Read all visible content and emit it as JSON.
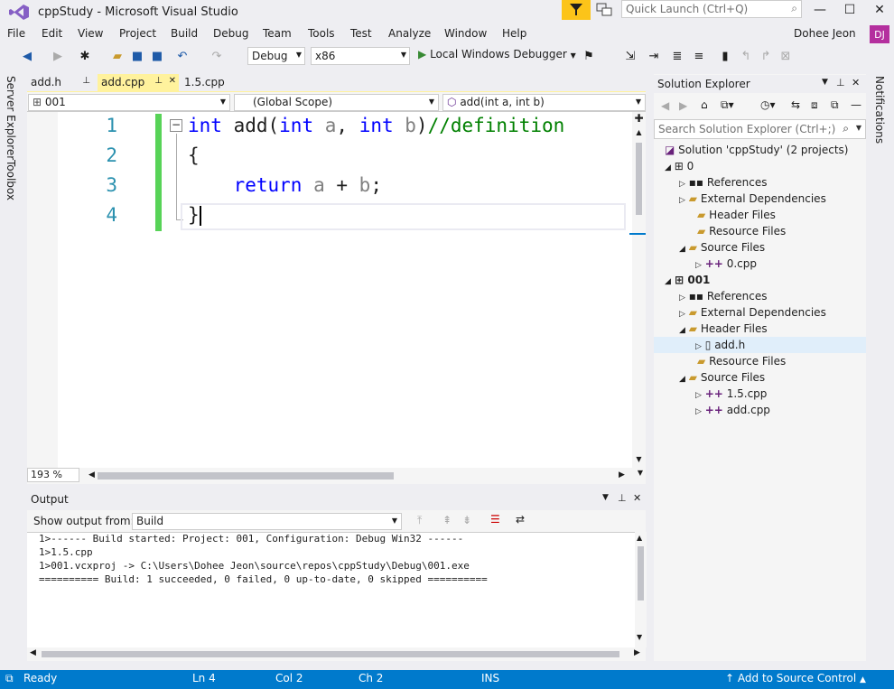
{
  "window": {
    "title": "cppStudy - Microsoft Visual Studio",
    "quick_launch_placeholder": "Quick Launch (Ctrl+Q)"
  },
  "menu": [
    "File",
    "Edit",
    "View",
    "Project",
    "Build",
    "Debug",
    "Team",
    "Tools",
    "Test",
    "Analyze",
    "Window",
    "Help"
  ],
  "user": {
    "name": "Dohee Jeon",
    "initials": "DJ"
  },
  "toolbar": {
    "config": "Debug",
    "platform": "x86",
    "debugger": "Local Windows Debugger"
  },
  "side_tabs": {
    "left": [
      "Server Explorer",
      "Toolbox"
    ],
    "right": "Notifications"
  },
  "editor": {
    "tabs": [
      "add.h",
      "add.cpp",
      "1.5.cpp"
    ],
    "active_tab": "add.cpp",
    "nav": {
      "project": "001",
      "scope": "(Global Scope)",
      "member": "add(int a, int b)"
    },
    "line_numbers": [
      "1",
      "2",
      "3",
      "4"
    ],
    "code": {
      "l1_kw1": "int",
      "l1_fn": " add(",
      "l1_kw2": "int",
      "l1_a": " a",
      "l1_sep": ", ",
      "l1_kw3": "int",
      "l1_b": " b",
      "l1_close": ")",
      "l1_comment": "//definition",
      "l2": "{",
      "l3_indent": "    ",
      "l3_kw": "return",
      "l3_a": " a",
      "l3_plus": " + ",
      "l3_b": "b",
      "l3_semi": ";",
      "l4": "}"
    },
    "zoom": "193 %"
  },
  "output": {
    "title": "Output",
    "show_from_label": "Show output from:",
    "source": "Build",
    "lines": [
      "1>------ Build started: Project: 001, Configuration: Debug Win32 ------",
      "1>1.5.cpp",
      "1>001.vcxproj -> C:\\Users\\Dohee Jeon\\source\\repos\\cppStudy\\Debug\\001.exe",
      "========== Build: 1 succeeded, 0 failed, 0 up-to-date, 0 skipped =========="
    ]
  },
  "solution_explorer": {
    "title": "Solution Explorer",
    "search_placeholder": "Search Solution Explorer (Ctrl+;)",
    "solution": "Solution 'cppStudy' (2 projects)",
    "items": [
      {
        "label": "0"
      },
      {
        "label": "References"
      },
      {
        "label": "External Dependencies"
      },
      {
        "label": "Header Files"
      },
      {
        "label": "Resource Files"
      },
      {
        "label": "Source Files"
      },
      {
        "label": "0.cpp"
      },
      {
        "label": "001"
      },
      {
        "label": "References"
      },
      {
        "label": "External Dependencies"
      },
      {
        "label": "Header Files"
      },
      {
        "label": "add.h"
      },
      {
        "label": "Resource Files"
      },
      {
        "label": "Source Files"
      },
      {
        "label": "1.5.cpp"
      },
      {
        "label": "add.cpp"
      }
    ]
  },
  "status": {
    "ready": "Ready",
    "ln": "Ln 4",
    "col": "Col 2",
    "ch": "Ch 2",
    "mode": "INS",
    "source_control": "Add to Source Control"
  },
  "colors": {
    "accent": "#007acc",
    "keyword": "#0000ff",
    "comment": "#008000",
    "line_number": "#2b91af",
    "active_tab": "#fff29d",
    "change_bar": "#57d357"
  }
}
